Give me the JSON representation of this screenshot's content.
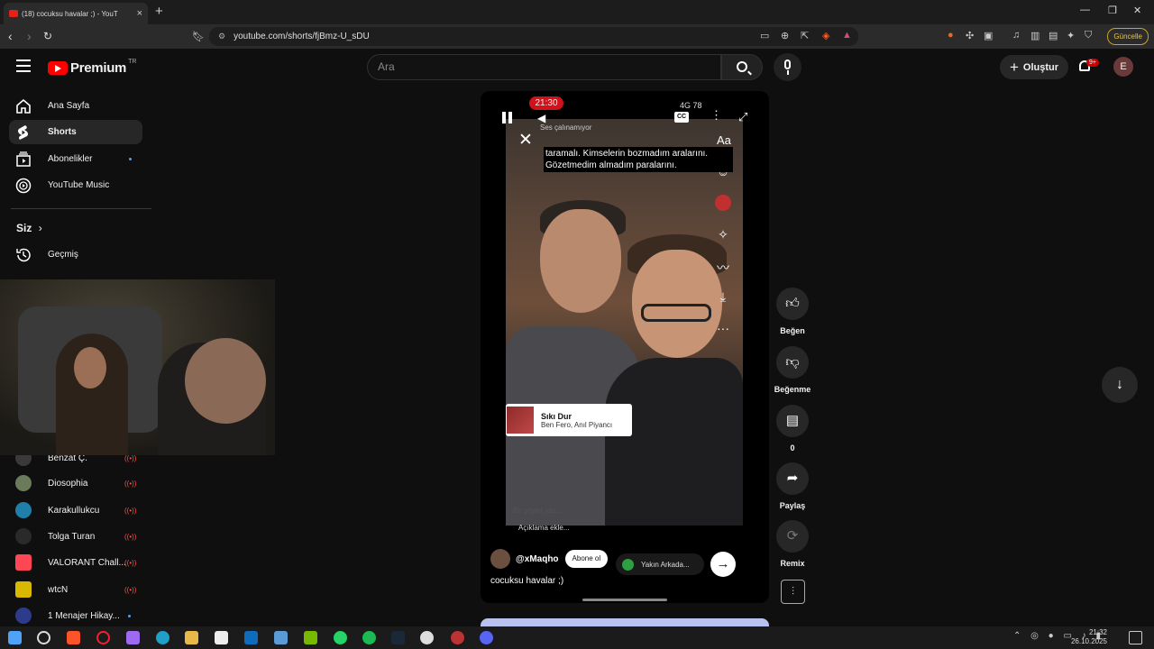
{
  "browser": {
    "tab_title": "(18) cocuksu havalar ;) - YouT",
    "url": "youtube.com/shorts/fjBmz-U_sDU",
    "update_label": "Güncelle"
  },
  "header": {
    "logo_text": "Premium",
    "country_code": "TR",
    "search_placeholder": "Ara",
    "create_label": "Oluştur",
    "notification_count": "9+",
    "avatar_letter": "E"
  },
  "sidebar": {
    "main_items": [
      {
        "label": "Ana Sayfa",
        "icon": "home-icon"
      },
      {
        "label": "Shorts",
        "icon": "shorts-icon"
      },
      {
        "label": "Abonelikler",
        "icon": "subscriptions-icon"
      },
      {
        "label": "YouTube Music",
        "icon": "youtube-music-icon"
      }
    ],
    "you_label": "Siz",
    "history_label": "Geçmiş",
    "subscriptions": [
      {
        "label": "Benzat Ç.",
        "live": true
      },
      {
        "label": "Diosophia",
        "live": true
      },
      {
        "label": "Karakullukcu",
        "live": true
      },
      {
        "label": "Tolga Turan",
        "live": true
      },
      {
        "label": "VALORANT Chall...",
        "live": true
      },
      {
        "label": "wtcN",
        "live": true
      },
      {
        "label": "1 Menajer Hikay...",
        "live": false
      }
    ]
  },
  "player": {
    "status_time": "21:30",
    "status_right": "4G 78",
    "sound_status": "Ses çalınamıyor",
    "cc_label": "CC",
    "aa_label": "Aa",
    "caption": "taramalı. Kimselerin bozmadım aralarını. Gözetmedim almadım paralarını.",
    "music_title": "Sıkı Dur",
    "music_artist": "Ben Fero, Anıl Piyancı",
    "faint_text": "Bir şeyler yaz...",
    "add_description": "Açıklama ekle...",
    "channel_handle": "@xMaqho",
    "subscribe_label": "Abone ol",
    "close_friends_label": "Yakın Arkada...",
    "video_title": "cocuksu havalar ;)"
  },
  "actions": {
    "like_label": "Beğen",
    "dislike_label": "Beğenme",
    "comments_count": "0",
    "share_label": "Paylaş",
    "remix_label": "Remix"
  },
  "taskbar": {
    "time": "21:32",
    "date": "26.10.2025"
  },
  "colors": {
    "brand_red": "#ff0000",
    "background": "#0f0f0f",
    "chip": "#272727"
  }
}
